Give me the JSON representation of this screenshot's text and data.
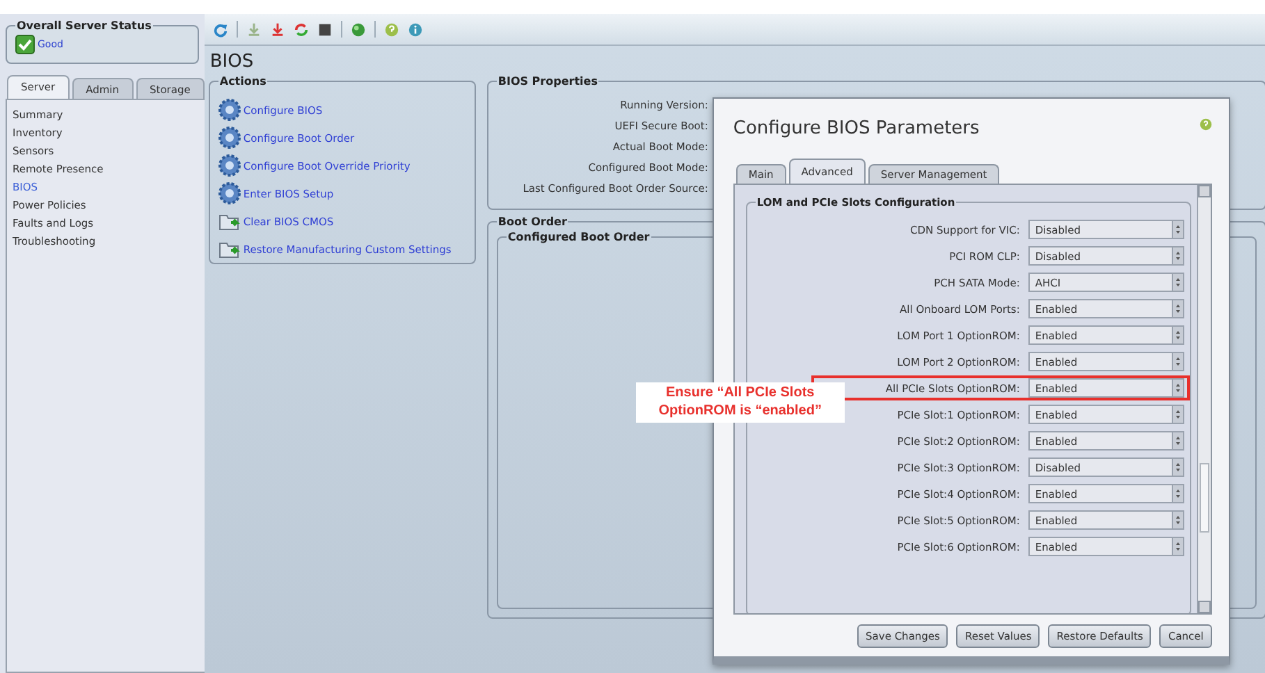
{
  "server_status": {
    "title": "Overall Server Status",
    "value": "Good"
  },
  "nav_tabs": [
    {
      "label": "Server",
      "selected": true
    },
    {
      "label": "Admin",
      "selected": false
    },
    {
      "label": "Storage",
      "selected": false
    }
  ],
  "nav_items": [
    {
      "label": "Summary",
      "selected": false
    },
    {
      "label": "Inventory",
      "selected": false
    },
    {
      "label": "Sensors",
      "selected": false
    },
    {
      "label": "Remote Presence",
      "selected": false
    },
    {
      "label": "BIOS",
      "selected": true
    },
    {
      "label": "Power Policies",
      "selected": false
    },
    {
      "label": "Faults and Logs",
      "selected": false
    },
    {
      "label": "Troubleshooting",
      "selected": false
    }
  ],
  "toolbar": [
    {
      "kind": "refresh"
    },
    {
      "kind": "sep"
    },
    {
      "kind": "power-on"
    },
    {
      "kind": "power-off"
    },
    {
      "kind": "cycle"
    },
    {
      "kind": "stop"
    },
    {
      "kind": "sep"
    },
    {
      "kind": "globe"
    },
    {
      "kind": "sep"
    },
    {
      "kind": "help"
    },
    {
      "kind": "info"
    }
  ],
  "page_title": "BIOS",
  "actions": {
    "title": "Actions",
    "items": [
      {
        "kind": "gear",
        "label": "Configure BIOS"
      },
      {
        "kind": "gear",
        "label": "Configure Boot Order"
      },
      {
        "kind": "gear",
        "label": "Configure Boot Override Priority"
      },
      {
        "kind": "gear",
        "label": "Enter BIOS Setup"
      },
      {
        "kind": "folder",
        "label": "Clear BIOS CMOS"
      },
      {
        "kind": "folder",
        "label": "Restore Manufacturing Custom Settings"
      }
    ]
  },
  "bios_properties": {
    "title": "BIOS Properties",
    "labels": [
      "Running Version:",
      "UEFI Secure Boot:",
      "Actual Boot Mode:",
      "Configured Boot Mode:",
      "Last Configured Boot Order Source:"
    ]
  },
  "boot_order": {
    "title": "Boot Order",
    "subtitle": "Configured Boot Order"
  },
  "dialog": {
    "title": "Configure BIOS Parameters",
    "tabs": [
      {
        "label": "Main",
        "selected": false
      },
      {
        "label": "Advanced",
        "selected": true
      },
      {
        "label": "Server Management",
        "selected": false
      }
    ],
    "section": "LOM and PCIe Slots Configuration",
    "rows": [
      {
        "label": "CDN Support for VIC:",
        "value": "Disabled",
        "highlighted": false
      },
      {
        "label": "PCI ROM CLP:",
        "value": "Disabled",
        "highlighted": false
      },
      {
        "label": "PCH SATA Mode:",
        "value": "AHCI",
        "highlighted": false
      },
      {
        "label": "All Onboard LOM Ports:",
        "value": "Enabled",
        "highlighted": false
      },
      {
        "label": "LOM Port 1 OptionROM:",
        "value": "Enabled",
        "highlighted": false
      },
      {
        "label": "LOM Port 2 OptionROM:",
        "value": "Enabled",
        "highlighted": false
      },
      {
        "label": "All PCIe Slots OptionROM:",
        "value": "Enabled",
        "highlighted": true
      },
      {
        "label": "PCIe Slot:1 OptionROM:",
        "value": "Enabled",
        "highlighted": false
      },
      {
        "label": "PCIe Slot:2 OptionROM:",
        "value": "Enabled",
        "highlighted": false
      },
      {
        "label": "PCIe Slot:3 OptionROM:",
        "value": "Disabled",
        "highlighted": false
      },
      {
        "label": "PCIe Slot:4 OptionROM:",
        "value": "Enabled",
        "highlighted": false
      },
      {
        "label": "PCIe Slot:5 OptionROM:",
        "value": "Enabled",
        "highlighted": false
      },
      {
        "label": "PCIe Slot:6 OptionROM:",
        "value": "Enabled",
        "highlighted": false
      }
    ],
    "buttons": [
      "Save Changes",
      "Reset Values",
      "Restore Defaults",
      "Cancel"
    ]
  },
  "annotation": "Ensure “All PCIe Slots OptionROM is “enabled”"
}
